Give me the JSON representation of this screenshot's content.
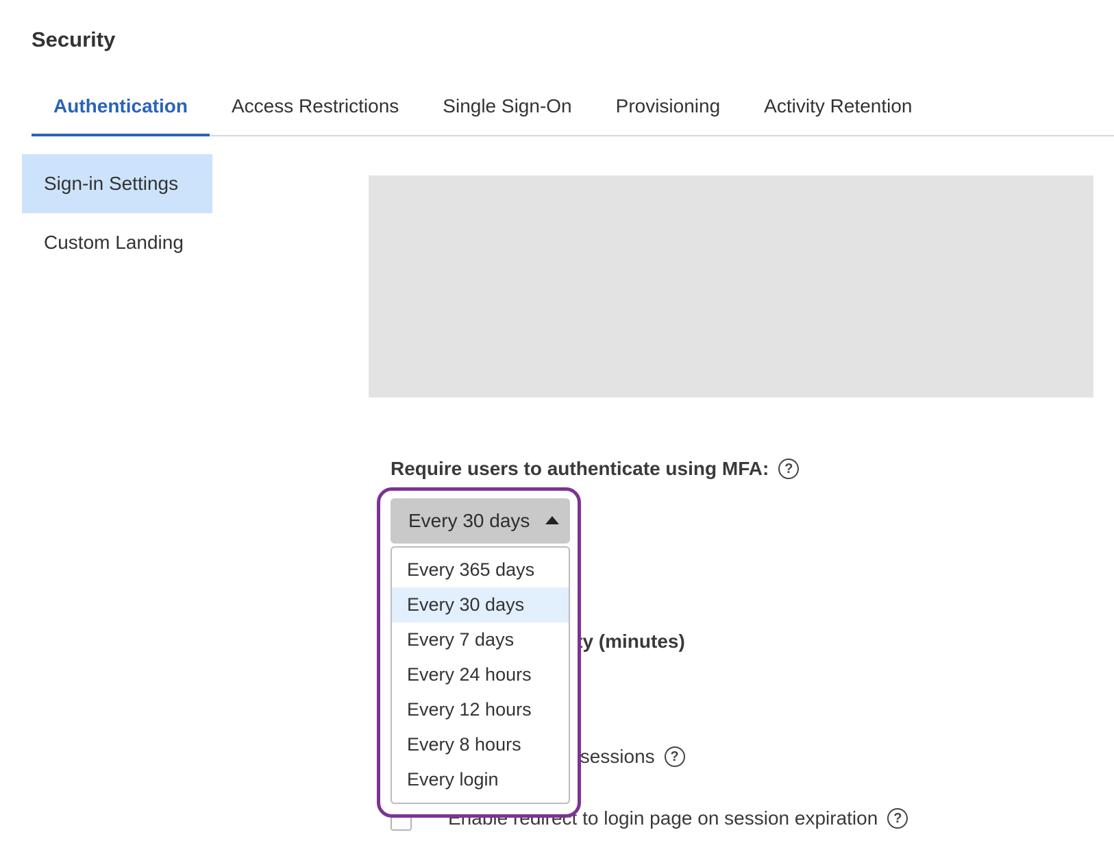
{
  "page": {
    "title": "Security"
  },
  "tabs": [
    {
      "label": "Authentication",
      "active": true
    },
    {
      "label": "Access Restrictions",
      "active": false
    },
    {
      "label": "Single Sign-On",
      "active": false
    },
    {
      "label": "Provisioning",
      "active": false
    },
    {
      "label": "Activity Retention",
      "active": false
    }
  ],
  "sidebar": {
    "items": [
      {
        "label": "Sign-in Settings",
        "active": true
      },
      {
        "label": "Custom Landing",
        "active": false
      }
    ]
  },
  "mfa": {
    "label": "Require users to authenticate using MFA:",
    "help_icon": "question-circle-icon",
    "select": {
      "value": "Every 30 days",
      "expanded": true,
      "caret_icon": "caret-up-icon"
    },
    "options": [
      {
        "label": "Every 365 days",
        "selected": false
      },
      {
        "label": "Every 30 days",
        "selected": true
      },
      {
        "label": "Every 7 days",
        "selected": false
      },
      {
        "label": "Every 24 hours",
        "selected": false
      },
      {
        "label": "Every 12 hours",
        "selected": false
      },
      {
        "label": "Every 8 hours",
        "selected": false
      },
      {
        "label": "Every login",
        "selected": false
      }
    ]
  },
  "obscured": {
    "inactivity_heading_visible": "ivity (minutes)",
    "sessions_label_visible": "ted sessions",
    "redirect_label": "Enable redirect to login page on session expiration",
    "redirect_checked": false
  },
  "colors": {
    "accent": "#2a63b8",
    "sidebar_active": "#cce3fb",
    "option_selected": "#e2effd",
    "highlight_border": "#7d3294",
    "placeholder": "#e3e3e3",
    "select_bg": "#c9c9c9"
  }
}
